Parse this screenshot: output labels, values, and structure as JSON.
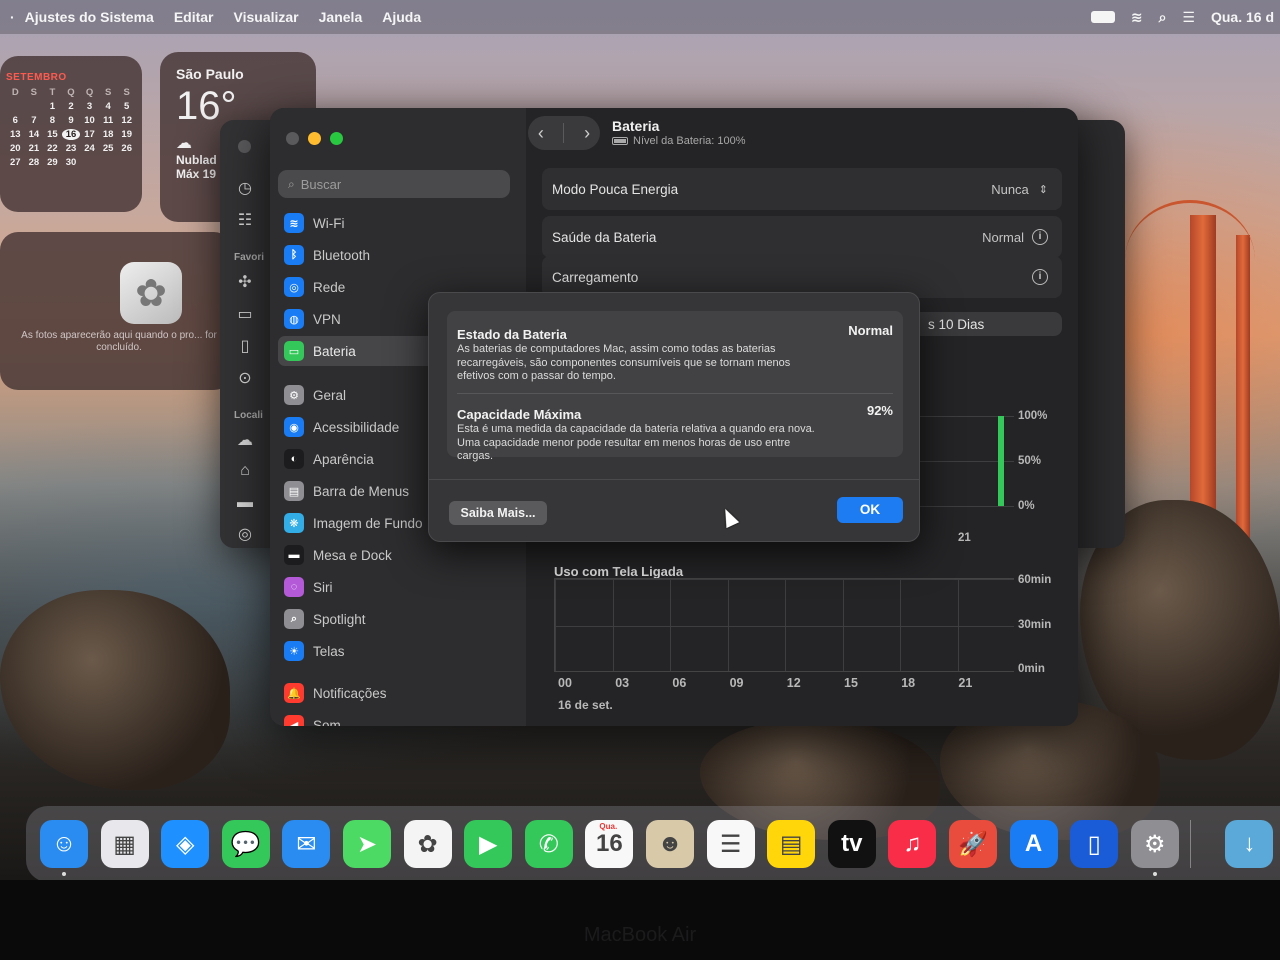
{
  "menubar": {
    "app_name": "Ajustes do Sistema",
    "menus": [
      "Editar",
      "Visualizar",
      "Janela",
      "Ajuda"
    ],
    "clock": "Qua. 16 d"
  },
  "widgets": {
    "calendar": {
      "month": "SETEMBRO",
      "weekdays": [
        "D",
        "S",
        "T",
        "Q",
        "Q",
        "S",
        "S"
      ],
      "days": [
        "",
        "",
        "1",
        "2",
        "3",
        "4",
        "5",
        "6",
        "7",
        "8",
        "9",
        "10",
        "11",
        "12",
        "13",
        "14",
        "15",
        "16",
        "17",
        "18",
        "19",
        "20",
        "21",
        "22",
        "23",
        "24",
        "25",
        "26",
        "27",
        "28",
        "29",
        "30",
        "",
        "",
        ""
      ],
      "today": "16"
    },
    "weather": {
      "city": "São Paulo",
      "temperature": "16°",
      "condition": "Nublad",
      "high": "Máx 19"
    },
    "photos": {
      "message": "As fotos aparecerão aqui quando o pro... for concluído."
    }
  },
  "back_window": {
    "labels": [
      "Favori",
      "Locali"
    ]
  },
  "settings": {
    "search_placeholder": "Buscar",
    "sidebar": [
      {
        "label": "Wi-Fi",
        "color": "#1a7cf5",
        "glyph": "≋"
      },
      {
        "label": "Bluetooth",
        "color": "#1a7cf5",
        "glyph": "ᛒ"
      },
      {
        "label": "Rede",
        "color": "#1a7cf5",
        "glyph": "◎"
      },
      {
        "label": "VPN",
        "color": "#1a7cf5",
        "glyph": "◍"
      },
      {
        "label": "Bateria",
        "color": "#34c759",
        "glyph": "▭",
        "selected": true
      },
      {
        "label": "Geral",
        "color": "#8e8e93",
        "glyph": "⚙"
      },
      {
        "label": "Acessibilidade",
        "color": "#1a7cf5",
        "glyph": "◉"
      },
      {
        "label": "Aparência",
        "color": "#1c1c1e",
        "glyph": "◐"
      },
      {
        "label": "Barra de Menus",
        "color": "#8e8e93",
        "glyph": "▤"
      },
      {
        "label": "Imagem de Fundo",
        "color": "#32ade6",
        "glyph": "❋"
      },
      {
        "label": "Mesa e Dock",
        "color": "#1c1c1e",
        "glyph": "▬"
      },
      {
        "label": "Siri",
        "color": "#b45ad8",
        "glyph": "◌"
      },
      {
        "label": "Spotlight",
        "color": "#8e8e93",
        "glyph": "⌕"
      },
      {
        "label": "Telas",
        "color": "#1a7cf5",
        "glyph": "☀"
      },
      {
        "label": "Notificações",
        "color": "#ff3b30",
        "glyph": "🔔"
      },
      {
        "label": "Som",
        "color": "#ff3b30",
        "glyph": "◀"
      }
    ],
    "toolbar": {
      "title": "Bateria",
      "subtitle": "Nível da Bateria: 100%"
    },
    "rows": {
      "low_power": {
        "label": "Modo Pouca Energia",
        "value": "Nunca"
      },
      "health": {
        "label": "Saúde da Bateria",
        "value": "Normal"
      },
      "charging": {
        "label": "Carregamento"
      }
    },
    "range_tab": "s 10 Dias",
    "chart1": {
      "y_labels": [
        "100%",
        "50%",
        "0%"
      ],
      "x_partial": "21"
    },
    "chart2": {
      "title": "Uso com Tela Ligada",
      "y_labels": [
        "60min",
        "30min",
        "0min"
      ],
      "x_labels": [
        "00",
        "03",
        "06",
        "09",
        "12",
        "15",
        "18",
        "21"
      ],
      "date": "16 de set."
    }
  },
  "alert": {
    "section1": {
      "title": "Estado da Bateria",
      "value": "Normal",
      "desc": "As baterias de computadores Mac, assim como todas as baterias recarregáveis, são componentes consumíveis que se tornam menos efetivos com o passar do tempo."
    },
    "section2": {
      "title": "Capacidade Máxima",
      "value": "92%",
      "desc": "Esta é uma medida da capacidade da bateria relativa a quando era nova. Uma capacidade menor pode resultar em menos horas de uso entre cargas."
    },
    "help_button": "Saiba Mais...",
    "ok_button": "OK"
  },
  "dock": {
    "apps": [
      {
        "name": "finder",
        "color": "#2a8cf0",
        "glyph": "☺"
      },
      {
        "name": "launchpad",
        "color": "#e8e8ec",
        "glyph": "▦"
      },
      {
        "name": "safari",
        "color": "#1e90ff",
        "glyph": "◈"
      },
      {
        "name": "messages",
        "color": "#34c759",
        "glyph": "💬"
      },
      {
        "name": "mail",
        "color": "#2a8cf0",
        "glyph": "✉"
      },
      {
        "name": "maps",
        "color": "#4cd964",
        "glyph": "➤"
      },
      {
        "name": "photos",
        "color": "#f4f4f4",
        "glyph": "✿"
      },
      {
        "name": "facetime",
        "color": "#34c759",
        "glyph": "▶"
      },
      {
        "name": "phone",
        "color": "#34c759",
        "glyph": "✆"
      },
      {
        "name": "calendar",
        "color": "#f8f8f8",
        "glyph": "16"
      },
      {
        "name": "contacts",
        "color": "#d8c9a8",
        "glyph": "☻"
      },
      {
        "name": "reminders",
        "color": "#f8f8f8",
        "glyph": "☰"
      },
      {
        "name": "notes",
        "color": "#ffd60a",
        "glyph": "▤"
      },
      {
        "name": "tv",
        "color": "#111111",
        "glyph": "tv"
      },
      {
        "name": "music",
        "color": "#fa2d48",
        "glyph": "♫"
      },
      {
        "name": "rocket",
        "color": "#e94b3c",
        "glyph": "🚀"
      },
      {
        "name": "app-store",
        "color": "#1a7cf5",
        "glyph": "A"
      },
      {
        "name": "simulator",
        "color": "#1a5cd8",
        "glyph": "▯"
      },
      {
        "name": "system-settings",
        "color": "#8e8e93",
        "glyph": "⚙"
      },
      {
        "name": "downloads",
        "color": "#5aa9d8",
        "glyph": "↓"
      }
    ],
    "calendar_day": "Qua."
  },
  "device_label": "MacBook Air"
}
